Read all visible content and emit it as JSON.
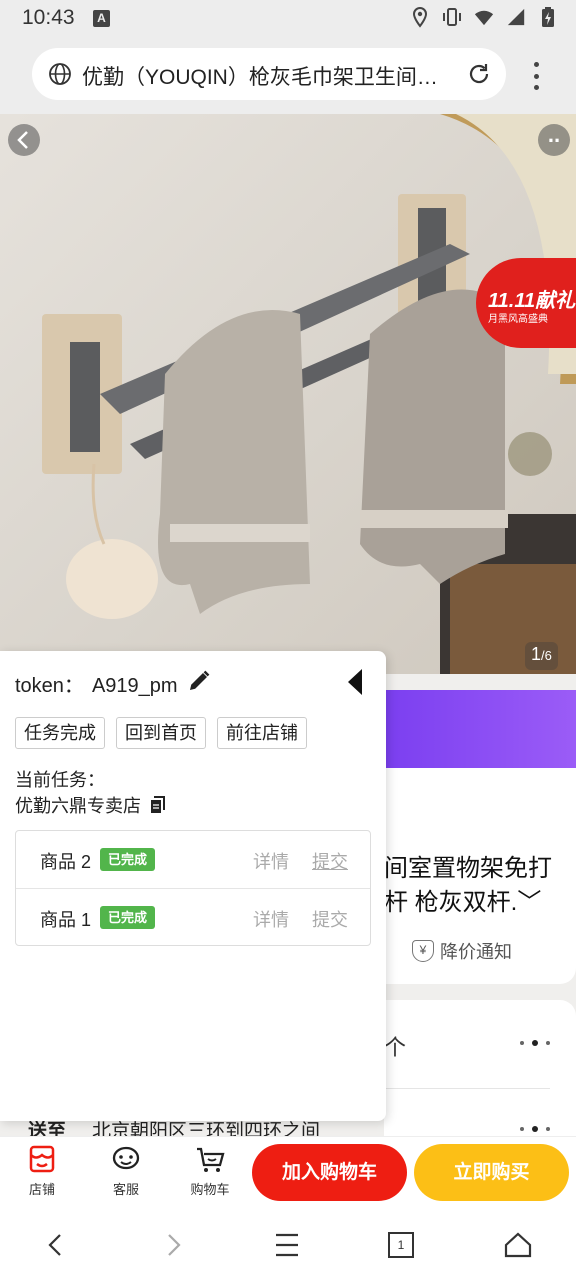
{
  "status_bar": {
    "time": "10:43",
    "app_icon_letter": "A"
  },
  "browser": {
    "url_title": "优勤（YOUQIN）枪灰毛巾架卫生间…"
  },
  "hero": {
    "promo_title": "11.11献礼",
    "promo_subtitle": "月黑风高盛典",
    "counter_current": "1",
    "counter_total": "/6"
  },
  "product": {
    "title_line1": "间室置物架免打",
    "title_line2": "杆 枪灰双杆.﹀",
    "price_notice": "降价通知",
    "section_glyph": "个",
    "shipping_label": "送至",
    "shipping_address": "北京朝阳区三环到四环之间"
  },
  "panel": {
    "token_label": "token：",
    "token_value": "A919_pm",
    "buttons": [
      "任务完成",
      "回到首页",
      "前往店铺"
    ],
    "current_task_label": "当前任务：",
    "current_shop": "优勤六鼎专卖店",
    "rows": [
      {
        "name": "商品 2",
        "status": "已完成",
        "detail": "详情",
        "submit": "提交"
      },
      {
        "name": "商品 1",
        "status": "已完成",
        "detail": "详情",
        "submit": "提交"
      }
    ]
  },
  "action_bar": {
    "shop": "店铺",
    "service": "客服",
    "cart": "购物车",
    "add_to_cart": "加入购物车",
    "buy_now": "立即购买"
  },
  "colors": {
    "red": "#ee1e12",
    "yellow": "#fcbf16",
    "badge_green": "#52b54b",
    "purple": "#7b3ff0"
  },
  "nav": {
    "tab_count": "1"
  }
}
